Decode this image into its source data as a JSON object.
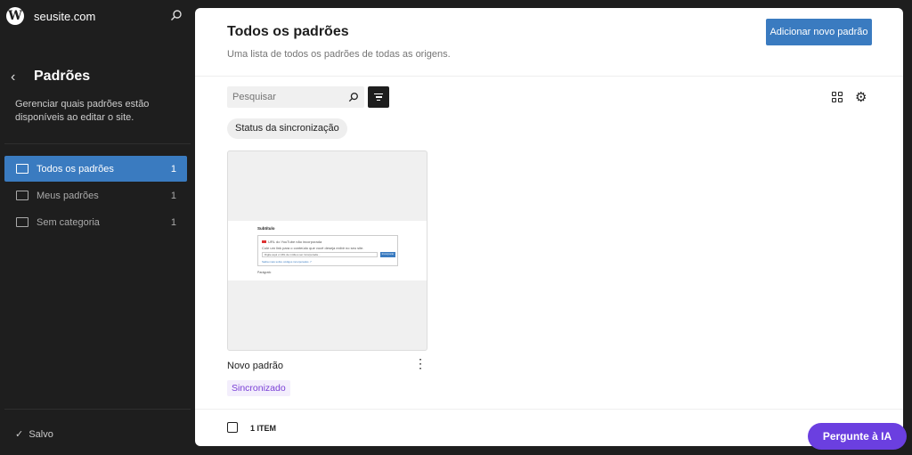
{
  "sidebar": {
    "site": "seusite.com",
    "title": "Padrões",
    "description": "Gerenciar quais padrões estão disponíveis ao editar o site.",
    "items": [
      {
        "label": "Todos os padrões",
        "count": "1"
      },
      {
        "label": "Meus padrões",
        "count": "1"
      },
      {
        "label": "Sem categoria",
        "count": "1"
      }
    ],
    "saved": "Salvo"
  },
  "main": {
    "title": "Todos os padrões",
    "subtitle": "Uma lista de todos os padrões de todas as origens.",
    "add_button": "Adicionar novo padrão",
    "search_placeholder": "Pesquisar",
    "filter_chip": "Status da sincronização",
    "card": {
      "title": "Novo padrão",
      "badge": "Sincronizado",
      "preview": {
        "heading": "Subtítulo",
        "embed_title": "URL do YouTube não incorporada",
        "embed_desc": "Cole um link para o conteúdo que você deseja exibir no seu site.",
        "input_placeholder": "Digite aqui o URL de mídia a ser incorporada...",
        "embed_button": "Incorporar",
        "learn_more": "Saiba mais sobre códigos incorporados ↗",
        "paragraph": "Parágrafo"
      }
    },
    "item_count": "1 ITEM"
  },
  "ai_button": "Pergunte à IA",
  "colors": {
    "accent": "#3a7bc0",
    "sidebar_bg": "#1e1e1e",
    "badge": "#7a3fd6",
    "ai": "#6b3fe0"
  }
}
